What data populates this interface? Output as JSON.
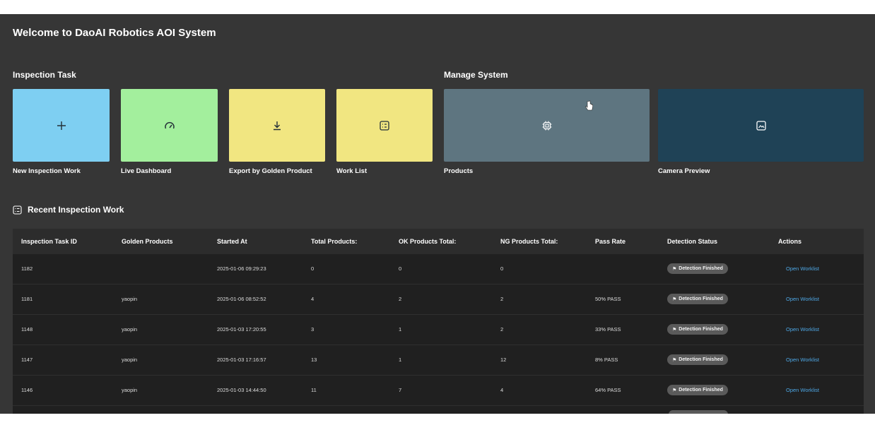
{
  "app_title": "Welcome to DaoAI Robotics AOI System",
  "sections": {
    "inspection_task": "Inspection Task",
    "manage_system": "Manage System"
  },
  "tiles": [
    {
      "label": "New Inspection Work",
      "icon": "plus-icon",
      "color": "#7ecff2"
    },
    {
      "label": "Live Dashboard",
      "icon": "gauge-icon",
      "color": "#a3ef9d"
    },
    {
      "label": "Export by Golden Product",
      "icon": "download-icon",
      "color": "#f1e681"
    },
    {
      "label": "Work List",
      "icon": "checklist-icon",
      "color": "#f1e681"
    },
    {
      "label": "Products",
      "icon": "chip-icon",
      "color": "#5e7580"
    },
    {
      "label": "Camera Preview",
      "icon": "image-icon",
      "color": "#1f4256"
    }
  ],
  "recent": {
    "title": "Recent Inspection Work",
    "icon": "list-icon",
    "columns": [
      "Inspection Task ID",
      "Golden Products",
      "Started At",
      "Total Products:",
      "OK Products Total:",
      "NG Products Total:",
      "Pass Rate",
      "Detection Status",
      "Actions"
    ],
    "rows": [
      {
        "id": "1182",
        "golden": "",
        "started": "2025-01-06 09:29:23",
        "total": "0",
        "ok": "0",
        "ng": "0",
        "pass_rate": "",
        "status": "Detection Finished",
        "action": "Open Worklist"
      },
      {
        "id": "1181",
        "golden": "yaopin",
        "started": "2025-01-06 08:52:52",
        "total": "4",
        "ok": "2",
        "ng": "2",
        "pass_rate": "50% PASS",
        "status": "Detection Finished",
        "action": "Open Worklist"
      },
      {
        "id": "1148",
        "golden": "yaopin",
        "started": "2025-01-03 17:20:55",
        "total": "3",
        "ok": "1",
        "ng": "2",
        "pass_rate": "33% PASS",
        "status": "Detection Finished",
        "action": "Open Worklist"
      },
      {
        "id": "1147",
        "golden": "yaopin",
        "started": "2025-01-03 17:16:57",
        "total": "13",
        "ok": "1",
        "ng": "12",
        "pass_rate": "8% PASS",
        "status": "Detection Finished",
        "action": "Open Worklist"
      },
      {
        "id": "1146",
        "golden": "yaopin",
        "started": "2025-01-03 14:44:50",
        "total": "11",
        "ok": "7",
        "ng": "4",
        "pass_rate": "64% PASS",
        "status": "Detection Finished",
        "action": "Open Worklist"
      }
    ]
  },
  "colors": {
    "background": "#363636",
    "table_row": "#202020",
    "table_header": "#2c2c2c",
    "link": "#4ea8e6",
    "badge": "#5a5a5a"
  }
}
